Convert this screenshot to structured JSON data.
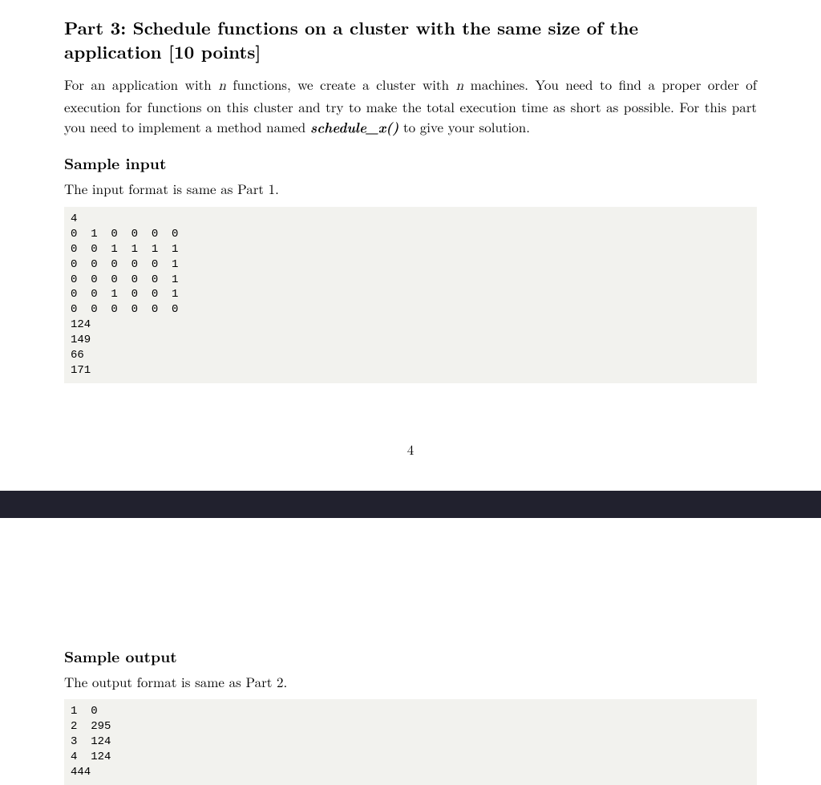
{
  "part3": {
    "title_a": "Part 3:  Schedule functions on a cluster with the same size of the",
    "title_b": "application [10 points]",
    "para_a": "For an application with ",
    "n": "n",
    "para_b": " functions, we create a cluster with ",
    "para_c": " machines.  You need to find a proper order of execution for functions on this cluster and try to make the total execution time as short as possible.  For this part you need to implement a method named ",
    "funcname": "schedule_x()",
    "para_d": " to give your solution.",
    "sample_input_head": "Sample input",
    "sample_input_note": "The input format is same as Part 1.",
    "sample_input_code": "4\n0  1  0  0  0  0\n0  0  1  1  1  1\n0  0  0  0  0  1\n0  0  0  0  0  1\n0  0  1  0  0  1\n0  0  0  0  0  0\n124\n149\n66\n171",
    "page_number": "4",
    "sample_output_head": "Sample output",
    "sample_output_note": "The output format is same as Part 2.",
    "sample_output_code": "1  0\n2  295\n3  124\n4  124\n444"
  }
}
